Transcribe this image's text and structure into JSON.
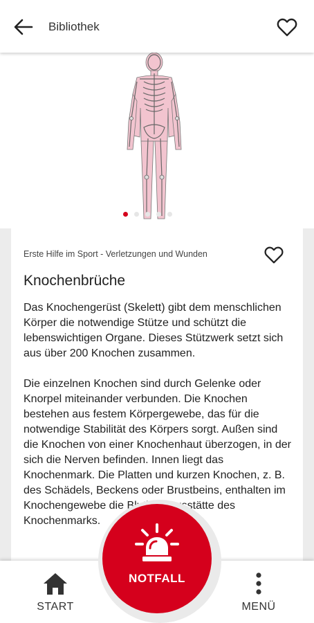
{
  "header": {
    "title": "Bibliothek",
    "back_icon": "arrow-left-icon",
    "favorite_icon": "heart-outline-icon"
  },
  "gallery": {
    "image": "skeleton-illustration",
    "dots_total": 5,
    "active_index": 0
  },
  "article": {
    "category": "Erste Hilfe im Sport - Verletzungen und Wunden",
    "title": "Knochenbrüche",
    "paragraphs": [
      "Das Knochengerüst (Skelett) gibt dem menschlichen Körper die notwendige Stütze und schützt die lebenswichtigen Organe. Dieses Stützwerk setzt sich aus über 200 Knochen zusammen.",
      "Die einzelnen Knochen sind durch Gelenke oder Knorpel miteinander verbunden. Die Knochen bestehen aus festem Körpergewebe, das für die notwendige Stabilität des Körpers sorgt. Außen sind die Knochen von einer Knochenhaut überzogen, in der sich die Nerven befinden. Innen liegt das Knochenmark. Die Platten und kurzen Knochen, z. B. des Schädels, Beckens oder Brustbeins, enthalten im Knochengewebe die Blutbildungsstätte des Knochenmarks."
    ]
  },
  "bottom_nav": {
    "start_label": "START",
    "menu_label": "MENÜ",
    "emergency_label": "NOTFALL"
  },
  "colors": {
    "accent": "#d5001c",
    "skeleton_fill": "#f2c4cf"
  }
}
